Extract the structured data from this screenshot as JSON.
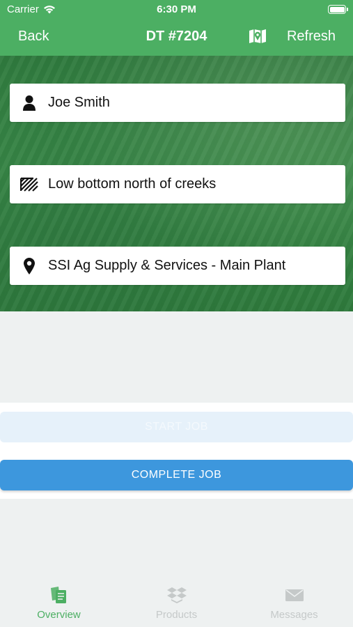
{
  "status_bar": {
    "carrier": "Carrier",
    "time": "6:30 PM"
  },
  "nav": {
    "back_label": "Back",
    "title": "DT #7204",
    "map_icon": "map-icon",
    "refresh_label": "Refresh"
  },
  "info": {
    "customer": {
      "icon": "person-icon",
      "text": "Joe Smith"
    },
    "field": {
      "icon": "field-icon",
      "text": "Low bottom north of creeks"
    },
    "location": {
      "icon": "location-pin-icon",
      "text": "SSI Ag Supply & Services - Main Plant"
    }
  },
  "actions": {
    "start_label": "START JOB",
    "complete_label": "COMPLETE JOB"
  },
  "tabs": [
    {
      "label": "Overview",
      "icon": "overview-icon",
      "active": true
    },
    {
      "label": "Products",
      "icon": "products-icon",
      "active": false
    },
    {
      "label": "Messages",
      "icon": "messages-icon",
      "active": false
    }
  ],
  "colors": {
    "brand_green": "#4caf63",
    "button_blue": "#3d97dd",
    "inactive_gray": "#c5c9c9"
  }
}
